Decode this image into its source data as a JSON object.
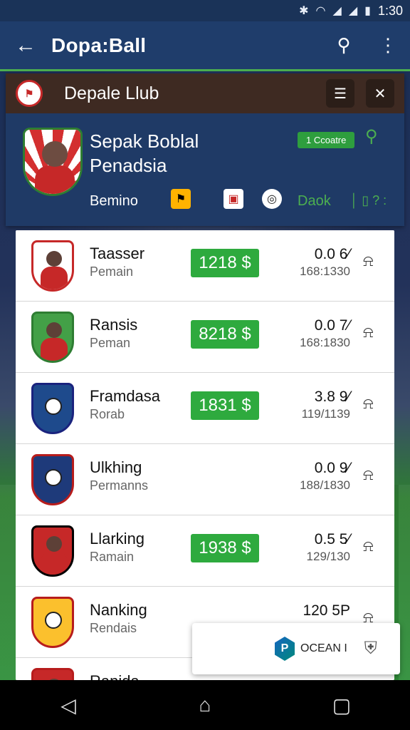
{
  "status": {
    "time": "1:30",
    "icons": [
      "bluetooth-icon",
      "wifi-icon",
      "signal-icon",
      "signal-icon",
      "battery-icon"
    ]
  },
  "appbar": {
    "title": "Dopa:Ball",
    "back_icon": "arrow-left-icon",
    "search_icon": "search-icon",
    "menu_icon": "more-vert-icon"
  },
  "club": {
    "name": "Depale Llub",
    "league_line1": "Sepak Boblal",
    "league_line2": "Penadsia",
    "badge": "1 Ccoatre",
    "sub": "Bemino",
    "link": "Daok",
    "link2": "│ ▯ ?  :"
  },
  "list": [
    {
      "name": "Taasser",
      "sub": "Pemain",
      "score": "1218 $",
      "odds": "0.0 6⁄",
      "time": "168:1330",
      "crest_color": "#c62828",
      "crest_bg": "#ffffff",
      "type": "person"
    },
    {
      "name": "Ransis",
      "sub": "Peman",
      "score": "8218 $",
      "odds": "0.0 7⁄",
      "time": "168:1830",
      "crest_color": "#2e7d32",
      "crest_bg": "#43a047",
      "type": "person"
    },
    {
      "name": "Framdasa",
      "sub": "Rorab",
      "score": "1831 $",
      "odds": "3.8 9⁄",
      "time": "119/1139",
      "crest_color": "#1a237e",
      "crest_bg": "#1e4a8c",
      "type": "ball"
    },
    {
      "name": "Ulkhing",
      "sub": "Permanns",
      "score": "",
      "odds": "0.0 9⁄",
      "time": "188/1830",
      "crest_color": "#b71c1c",
      "crest_bg": "#1e3a7a",
      "type": "ball"
    },
    {
      "name": "Llarking",
      "sub": "Ramain",
      "score": "1938 $",
      "odds": "0.5 5⁄",
      "time": "129/130",
      "crest_color": "#000000",
      "crest_bg": "#c62828",
      "type": "person"
    },
    {
      "name": "Nanking",
      "sub": "Rendais",
      "score": "",
      "odds": "120 5P",
      "time": "",
      "crest_color": "#b71c1c",
      "crest_bg": "#fbc02d",
      "type": "ball"
    },
    {
      "name": "Ranida",
      "sub": "",
      "score": "",
      "odds": "",
      "time": "",
      "crest_color": "#b71c1c",
      "crest_bg": "#c62828",
      "type": "person"
    }
  ],
  "popup": {
    "text": "OCEAN I",
    "logo_letter": "P"
  },
  "navbar": {
    "back": "◁",
    "home": "⌂",
    "recent": "▢"
  }
}
